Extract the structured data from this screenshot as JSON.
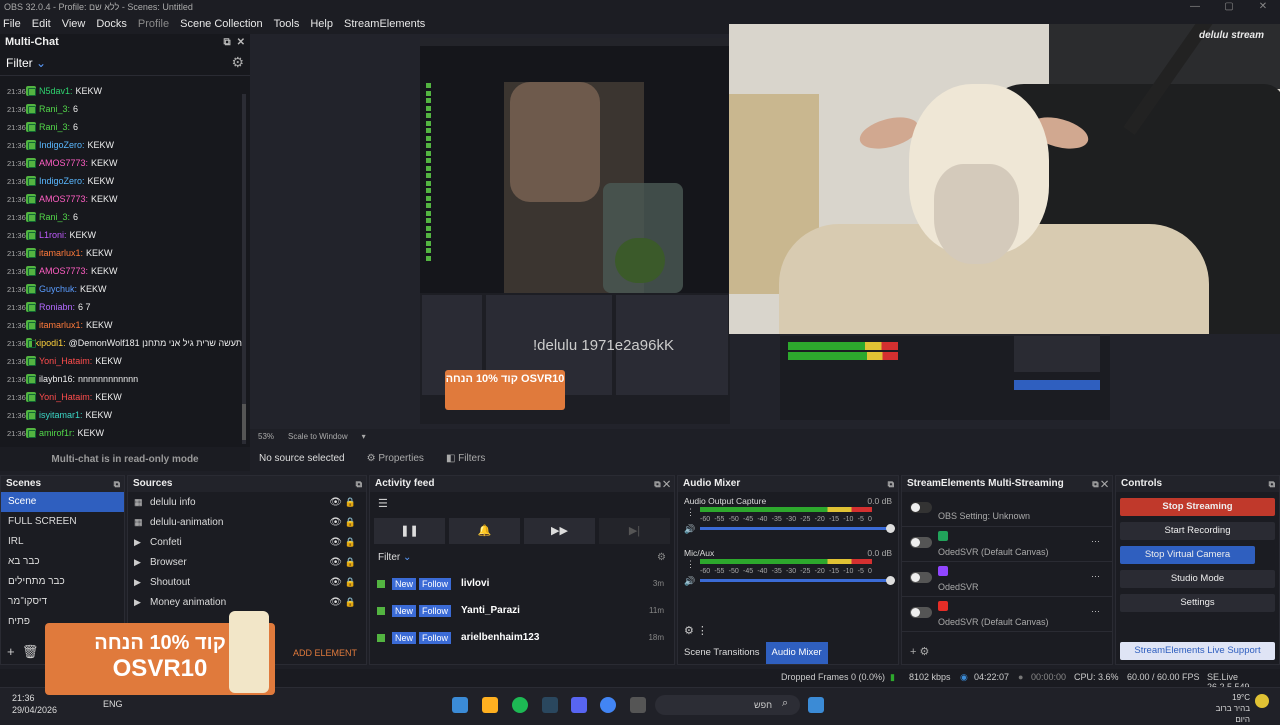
{
  "window": {
    "title": "OBS 32.0.4 - Profile: ללא שם - Scenes: Untitled"
  },
  "menu": [
    "File",
    "Edit",
    "View",
    "Docks",
    "Profile",
    "Scene Collection",
    "Tools",
    "Help",
    "StreamElements"
  ],
  "multichat": {
    "title": "Multi-Chat",
    "filter": "Filter",
    "footer": "Multi-chat is in read-only mode",
    "messages": [
      {
        "t": "21:36",
        "u": "N5dav1:",
        "x": "KEKW",
        "c": "#2fd36f"
      },
      {
        "t": "21:36",
        "u": "Rani_3:",
        "x": "6",
        "c": "#53d84a"
      },
      {
        "t": "21:36",
        "u": "Rani_3:",
        "x": "6",
        "c": "#53d84a"
      },
      {
        "t": "21:36",
        "u": "IndigoZero:",
        "x": "KEKW",
        "c": "#5ab8ff"
      },
      {
        "t": "21:36",
        "u": "AMOS7773:",
        "x": "KEKW",
        "c": "#ff5ec3"
      },
      {
        "t": "21:36",
        "u": "IndigoZero:",
        "x": "KEKW",
        "c": "#5ab8ff"
      },
      {
        "t": "21:36",
        "u": "AMOS7773:",
        "x": "KEKW",
        "c": "#ff5ec3"
      },
      {
        "t": "21:36",
        "u": "Rani_3:",
        "x": "6",
        "c": "#53d84a"
      },
      {
        "t": "21:36",
        "u": "L1roni:",
        "x": "KEKW",
        "c": "#c05bff"
      },
      {
        "t": "21:36",
        "u": "itamarlux1:",
        "x": "KEKW",
        "c": "#ff7a3b"
      },
      {
        "t": "21:36",
        "u": "AMOS7773:",
        "x": "KEKW",
        "c": "#ff5ec3"
      },
      {
        "t": "21:36",
        "u": "Guychuk:",
        "x": "KEKW",
        "c": "#5a9cff"
      },
      {
        "t": "21:36",
        "u": "Roniabn:",
        "x": "6 7",
        "c": "#b36bff"
      },
      {
        "t": "21:36",
        "u": "itamarlux1:",
        "x": "KEKW",
        "c": "#ff7a3b"
      },
      {
        "t": "21:36",
        "u": "kipodi1:",
        "x": "@DemonWolf181 תעשה שרית גיל אני מתחנן",
        "c": "#ffd23b"
      },
      {
        "t": "21:36",
        "u": "Yoni_Hataim:",
        "x": "KEKW",
        "c": "#ff4d4d"
      },
      {
        "t": "21:36",
        "u": "ilaybn16:",
        "x": "nnnnnnnnnnnn",
        "c": "#eee"
      },
      {
        "t": "21:36",
        "u": "Yoni_Hataim:",
        "x": "KEKW",
        "c": "#ff4d4d"
      },
      {
        "t": "21:36",
        "u": "isyitamar1:",
        "x": "KEKW",
        "c": "#3bd6c6"
      },
      {
        "t": "21:36",
        "u": "amirof1r:",
        "x": "KEKW",
        "c": "#53d84a"
      }
    ]
  },
  "preview": {
    "cam_logo": "delulu stream",
    "overlay": "!delulu 1971e2a96kK",
    "promo_small": "קוד 10% הנחה OSVR10",
    "zoom": "53%",
    "scale": "Scale to Window"
  },
  "infobar": {
    "no_source": "No source selected",
    "properties": "Properties",
    "filters": "Filters"
  },
  "scenes": {
    "title": "Scenes",
    "items": [
      "Scene",
      "FULL SCREEN",
      "IRL",
      "כבר בא",
      "כבר מתחילים",
      "דיסקו־מר",
      "פתיח"
    ]
  },
  "sources": {
    "title": "Sources",
    "items": [
      "delulu info",
      "delulu-animation",
      "Confeti",
      "Browser",
      "Shoutout",
      "Money animation"
    ],
    "add": "ADD ELEMENT"
  },
  "activity": {
    "title": "Activity feed",
    "filter": "Filter",
    "new": "New",
    "follow": "Follow",
    "items": [
      {
        "n": "livlovi",
        "t": "3m"
      },
      {
        "n": "Yanti_Parazi",
        "t": "11m"
      },
      {
        "n": "arielbenhaim123",
        "t": "18m"
      }
    ]
  },
  "mixer": {
    "title": "Audio Mixer",
    "ch1": "Audio Output Capture",
    "ch1db": "0.0 dB",
    "ch2": "Mic/Aux",
    "ch2db": "0.0 dB",
    "scale": [
      "-60",
      "-55",
      "-50",
      "-45",
      "-40",
      "-35",
      "-30",
      "-25",
      "-20",
      "-15",
      "-10",
      "-5",
      "0"
    ],
    "tab1": "Scene Transitions",
    "tab2": "Audio Mixer"
  },
  "multistream": {
    "title": "StreamElements Multi-Streaming",
    "obs": "OBS Setting: Unknown",
    "rows": [
      "OdedSVR (Default Canvas)",
      "OdedSVR",
      "OdedSVR (Default Canvas)"
    ]
  },
  "controls": {
    "title": "Controls",
    "stop": "Stop Streaming",
    "rec": "Start Recording",
    "vcam": "Stop Virtual Camera",
    "studio": "Studio Mode",
    "settings": "Settings",
    "support": "StreamElements Live Support"
  },
  "status": {
    "dropped": "Dropped Frames 0 (0.0%)",
    "kbps": "8102 kbps",
    "live": "04:22:07",
    "rec": "00:00:00",
    "cpu": "CPU: 3.6%",
    "fps": "60.00 / 60.00 FPS",
    "se": "SE.Live 26.2.5.549"
  },
  "taskbar": {
    "time": "21:36",
    "date": "29/04/2026",
    "lang": "ENG",
    "search": "חפש",
    "temp": "19°C",
    "weather": "בהיר ברוב היום"
  },
  "promo": {
    "line1": "קוד 10% הנחה",
    "line2": "OSVR10"
  }
}
